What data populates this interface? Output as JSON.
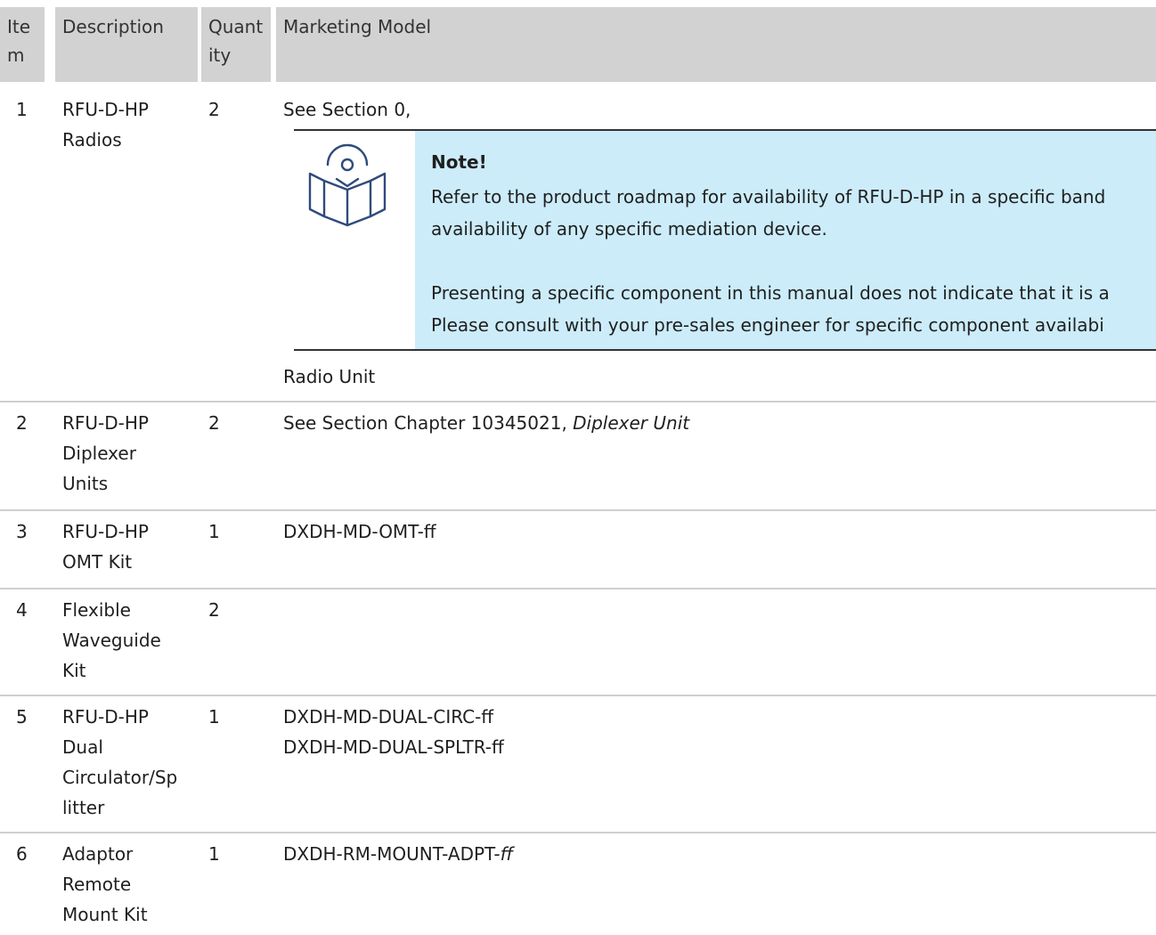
{
  "headers": {
    "item": "Ite\nm",
    "item_a": "Ite",
    "item_b": "m",
    "desc": "Description",
    "qty_a": "Quant",
    "qty_b": "ity",
    "model": "Marketing Model"
  },
  "rows": [
    {
      "item": "1",
      "desc": [
        "RFU-D-HP",
        "Radios"
      ],
      "qty": "2",
      "model_a": "See Section 0,",
      "model_b": "Radio Unit"
    },
    {
      "item": "2",
      "desc": [
        "RFU-D-HP",
        "Diplexer",
        "Units"
      ],
      "qty": "2",
      "model_plain": "See Section Chapter 10345021, ",
      "model_italic": "Diplexer Unit"
    },
    {
      "item": "3",
      "desc": [
        "RFU-D-HP",
        "OMT Kit"
      ],
      "qty": "1",
      "model": "DXDH-MD-OMT-ff"
    },
    {
      "item": "4",
      "desc": [
        "Flexible",
        "Waveguide",
        "Kit"
      ],
      "qty": "2",
      "model": ""
    },
    {
      "item": "5",
      "desc": [
        "RFU-D-HP",
        "Dual",
        "Circulator/Sp",
        "litter"
      ],
      "qty": "1",
      "model_lines": [
        "DXDH-MD-DUAL-CIRC-ff",
        "DXDH-MD-DUAL-SPLTR-ff"
      ]
    },
    {
      "item": "6",
      "desc": [
        "Adaptor",
        "Remote",
        "Mount Kit"
      ],
      "qty": "1",
      "model_plain": "DXDH-RM-MOUNT-ADPT-",
      "model_italic": "ff"
    }
  ],
  "note": {
    "title": "Note!",
    "lines": [
      "Refer to the product roadmap for availability of RFU-D-HP in a specific band",
      "availability of any specific mediation device.",
      "Presenting a specific component in this manual does not indicate that it is a",
      "Please consult with your pre-sales engineer for specific component availabi"
    ],
    "icon": "note-book-icon",
    "bg_color": "#ccecfa"
  }
}
